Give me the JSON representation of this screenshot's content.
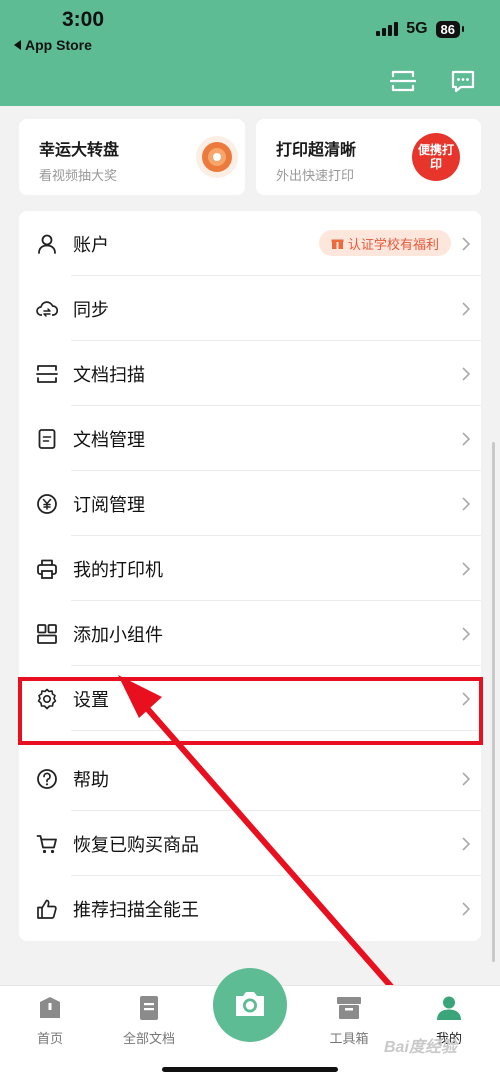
{
  "status_bar": {
    "time": "3:00",
    "back_label": "App Store",
    "network": "5G",
    "battery": "86"
  },
  "header": {
    "icons": [
      "scan-frame-icon",
      "message-icon"
    ]
  },
  "promo_cards": [
    {
      "title": "幸运大转盘",
      "subtitle": "看视频抽大奖",
      "icon": "prize-wheel-icon"
    },
    {
      "title": "打印超清晰",
      "subtitle": "外出快速打印",
      "icon": "portable-print-icon",
      "icon_text": "便携打印"
    }
  ],
  "menu": {
    "items": [
      {
        "label": "账户",
        "icon": "user-icon",
        "badge": "认证学校有福利"
      },
      {
        "label": "同步",
        "icon": "cloud-sync-icon"
      },
      {
        "label": "文档扫描",
        "icon": "scan-icon"
      },
      {
        "label": "文档管理",
        "icon": "document-icon"
      },
      {
        "label": "订阅管理",
        "icon": "yen-icon"
      },
      {
        "label": "我的打印机",
        "icon": "printer-icon"
      },
      {
        "label": "添加小组件",
        "icon": "widget-icon"
      },
      {
        "label": "设置",
        "icon": "gear-icon"
      },
      {
        "label": "帮助",
        "icon": "help-icon"
      },
      {
        "label": "恢复已购买商品",
        "icon": "cart-icon"
      },
      {
        "label": "推荐扫描全能王",
        "icon": "thumbs-up-icon"
      }
    ]
  },
  "tabbar": {
    "tabs": [
      {
        "label": "首页",
        "icon": "home-icon",
        "active": false
      },
      {
        "label": "全部文档",
        "icon": "all-docs-icon",
        "active": false
      },
      {
        "label": "工具箱",
        "icon": "toolbox-icon",
        "active": false
      },
      {
        "label": "我的",
        "icon": "profile-icon",
        "active": true
      }
    ],
    "camera_icon": "camera-icon"
  },
  "watermark": "Bai度经验",
  "colors": {
    "brand": "#5ebc95",
    "highlight": "#e8101f",
    "badge_text": "#e4583a",
    "badge_bg": "#fde7dd"
  }
}
